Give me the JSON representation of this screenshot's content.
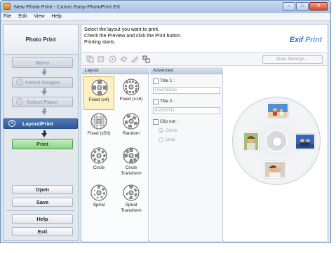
{
  "window": {
    "title": "New Photo Print - Canon Easy-PhotoPrint EX",
    "controls": [
      "–",
      "□",
      "✕"
    ]
  },
  "menu": [
    "File",
    "Edit",
    "View",
    "Help"
  ],
  "sidebar": {
    "header": "Photo Print",
    "steps": [
      {
        "num": "",
        "label": "Menu"
      },
      {
        "num": "1",
        "label": "Select Images"
      },
      {
        "num": "2",
        "label": "Select Paper"
      },
      {
        "num": "3",
        "label": "Layout/Print"
      }
    ],
    "print_label": "Print",
    "buttons": [
      "Open",
      "Save",
      "Help",
      "Exit"
    ]
  },
  "instructions": [
    "Select the layout you want to print.",
    "Check the Preview and click the Print button.",
    "Printing starts."
  ],
  "logo": {
    "part1": "Exif ",
    "part2": "Print"
  },
  "toolbar": {
    "icons": [
      "copy-icon",
      "duplicate-icon",
      "disc-icon",
      "stamp-icon",
      "tool-icon",
      "manage-icon"
    ],
    "date_settings": "Date Settings..."
  },
  "layout_panel": {
    "title": "Layout",
    "items": [
      {
        "label": "Fixed (x4)",
        "selected": true
      },
      {
        "label": "Fixed (x16)"
      },
      {
        "label": "Fixed (x50)"
      },
      {
        "label": "Random"
      },
      {
        "label": "Circle"
      },
      {
        "label": "Circle Transform"
      },
      {
        "label": "Spiral"
      },
      {
        "label": "Spiral Transform"
      }
    ]
  },
  "advanced_panel": {
    "title": "Advanced",
    "title1_label": "Title 1 :",
    "title1_value": "UserName",
    "title2_label": "Title 2 :",
    "title2_value": "8/20/2011",
    "clip_label": "Clip out :",
    "clip_options": [
      "Circle",
      "Oval"
    ]
  },
  "colors": {
    "active_step": "#2f5a98",
    "print_button": "#8ed486",
    "selection": "#fdf0c4",
    "logo": "#2f6fb8"
  }
}
